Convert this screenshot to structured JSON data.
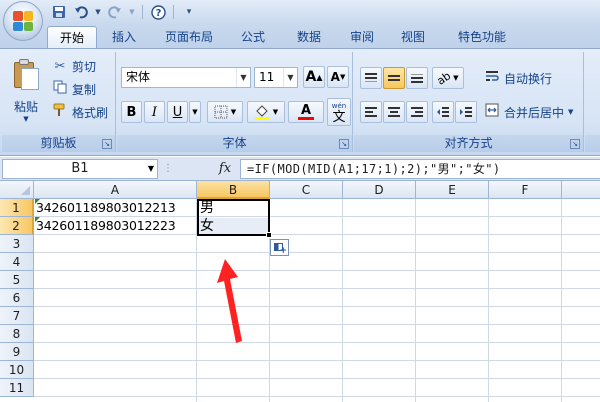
{
  "window": {
    "qat": [
      "save-icon",
      "undo-icon",
      "redo-icon",
      "help-icon",
      "customize-icon"
    ]
  },
  "tabs": [
    "开始",
    "插入",
    "页面布局",
    "公式",
    "数据",
    "审阅",
    "视图",
    "特色功能"
  ],
  "active_tab": "开始",
  "ribbon": {
    "clipboard": {
      "label": "剪贴板",
      "paste": "粘贴",
      "cut": "剪切",
      "copy": "复制",
      "format_painter": "格式刷"
    },
    "font": {
      "label": "字体",
      "font_name": "宋体",
      "font_size": "11",
      "grow": "A",
      "shrink": "A",
      "bold": "B",
      "italic": "I",
      "underline": "U",
      "font_color_glyph": "A",
      "phonetic_top": "wén",
      "phonetic_glyph": "文"
    },
    "alignment": {
      "label": "对齐方式",
      "wrap_text": "自动换行",
      "merge_center": "合并后居中"
    }
  },
  "formula_bar": {
    "name_box": "B1",
    "fx": "fx",
    "formula": "=IF(MOD(MID(A1;17;1);2);\"男\";\"女\")"
  },
  "sheet": {
    "columns": [
      "A",
      "B",
      "C",
      "D",
      "E",
      "F"
    ],
    "selected_column": "B",
    "rows": [
      "1",
      "2",
      "3",
      "4",
      "5",
      "6",
      "7",
      "8",
      "9",
      "10",
      "11"
    ],
    "selected_rows": [
      "1",
      "2"
    ],
    "cells": {
      "A1": "342601189803012213",
      "A2": "342601189803012223",
      "B1": "男",
      "B2": "女"
    }
  },
  "colors": {
    "selection_border": "#000000",
    "header_highlight": "#f8c763",
    "annotation_arrow": "#ff2222",
    "error_triangle": "#2f8a2f"
  }
}
